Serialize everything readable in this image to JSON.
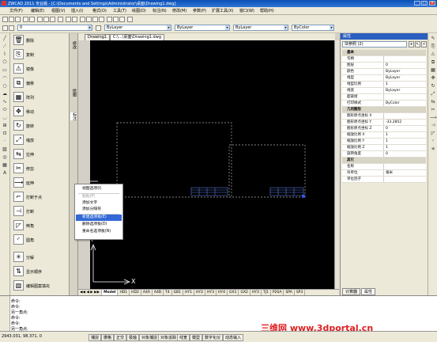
{
  "title": "ZWCAD 2011 专业版 - [C:\\Documents and Settings\\Administrator\\桌面\\Drawing1.dwg]",
  "window_buttons": [
    "_",
    "□",
    "×"
  ],
  "menu": [
    "文件(F)",
    "编辑(E)",
    "视图(V)",
    "插入(I)",
    "格式(O)",
    "工具(T)",
    "绘图(D)",
    "标注(N)",
    "修改(M)",
    "参数(P)",
    "扩展工具(X)",
    "窗口(W)",
    "帮助(H)"
  ],
  "toolbar": {
    "layer_value": "ByLayer",
    "style_value": "ByLayer",
    "line_value": "ByLayer",
    "color_value": "ByColor",
    "layer_combo": "0"
  },
  "cmd_panel": [
    {
      "icon": "🗑",
      "label": "删除"
    },
    {
      "icon": "⎘",
      "label": "复制"
    },
    {
      "icon": "⚠",
      "label": "镜像"
    },
    {
      "icon": "⧉",
      "label": "偏移"
    },
    {
      "icon": "▦",
      "label": "阵列"
    },
    {
      "icon": "✥",
      "label": "移动"
    },
    {
      "icon": "↻",
      "label": "旋转"
    },
    {
      "icon": "⤢",
      "label": "缩放"
    },
    {
      "icon": "⇆",
      "label": "拉伸"
    },
    {
      "icon": "✂",
      "label": "修剪"
    },
    {
      "icon": "⟶",
      "label": "延伸"
    },
    {
      "icon": "⌐",
      "label": "打断于点"
    },
    {
      "icon": "⊣",
      "label": "打断"
    },
    {
      "icon": "◸",
      "label": "倒角"
    },
    {
      "icon": "◜",
      "label": "圆角"
    },
    {
      "icon": "✳",
      "label": "分解"
    },
    {
      "icon": "⇅",
      "label": "显示顺序"
    },
    {
      "icon": "▧",
      "label": "编辑图案填充"
    }
  ],
  "side_tabs": [
    "修改",
    "绘图",
    "标注"
  ],
  "doc_tabs": [
    "Drawing1",
    "C:\\...\\桌面\\Drawing1.dwg"
  ],
  "layout_tabs": [
    "Model",
    "HD1",
    "HD2",
    "A4A",
    "A4B",
    "T4",
    "GB1",
    "HY1",
    "HY2",
    "HY3",
    "HY4",
    "GX1",
    "GX2",
    "HY3",
    "TJ1",
    "P2SA",
    "SPA",
    "SP3"
  ],
  "context_menu": [
    {
      "label": "视图选项(I)",
      "disabled": false,
      "hl": false
    },
    {
      "label": "粘贴(P)",
      "disabled": true,
      "hl": false
    },
    {
      "label": "添加文字",
      "disabled": false,
      "hl": false
    },
    {
      "label": "添加分隔符",
      "disabled": false,
      "hl": false
    },
    {
      "label": "新建选项板(E)",
      "disabled": false,
      "hl": true
    },
    {
      "label": "删除选项板(D)",
      "disabled": false,
      "hl": false
    },
    {
      "label": "重命名选项板(N)",
      "disabled": false,
      "hl": false
    }
  ],
  "props": {
    "header": "属性",
    "selected": "块参照 (2)",
    "rows": [
      {
        "k": "基本",
        "v": "",
        "cat": true
      },
      {
        "k": "句柄",
        "v": ""
      },
      {
        "k": "图层",
        "v": "0"
      },
      {
        "k": "颜色",
        "v": "ByLayer"
      },
      {
        "k": "线型",
        "v": "ByLayer"
      },
      {
        "k": "线型比例",
        "v": "1"
      },
      {
        "k": "线宽",
        "v": "ByLayer"
      },
      {
        "k": "超链接",
        "v": ""
      },
      {
        "k": "打印样式",
        "v": "ByColor"
      },
      {
        "k": "几何图形",
        "v": "",
        "cat": true
      },
      {
        "k": "图形原点坐标 X",
        "v": ""
      },
      {
        "k": "图形原点坐标 Y",
        "v": "-33.2852"
      },
      {
        "k": "图形原点坐标 Z",
        "v": "0"
      },
      {
        "k": "缩放比例 X",
        "v": "1"
      },
      {
        "k": "缩放比例 Y",
        "v": "1"
      },
      {
        "k": "缩放比例 Z",
        "v": "1"
      },
      {
        "k": "旋转角度",
        "v": "0"
      },
      {
        "k": "其它",
        "v": "",
        "cat": true
      },
      {
        "k": "名称",
        "v": ""
      },
      {
        "k": "块单位",
        "v": "毫米"
      },
      {
        "k": "单位因子",
        "v": ""
      }
    ],
    "bottom_tabs": [
      "计算器",
      "属性"
    ]
  },
  "cmdline": [
    "命令:",
    "命令:",
    "另一角点:",
    "命令:",
    "命令:",
    "另一角点:"
  ],
  "status": {
    "coords": "2943.031, 98.371, 0",
    "buttons": [
      "捕捉",
      "栅格",
      "正交",
      "极轴",
      "对象捕捉",
      "对象追踪",
      "线宽",
      "模型",
      "数字化仪",
      "动态输入"
    ]
  },
  "watermark": "三维网 www.3dportal.cn",
  "axis_x": "X",
  "axis_y": "Y"
}
